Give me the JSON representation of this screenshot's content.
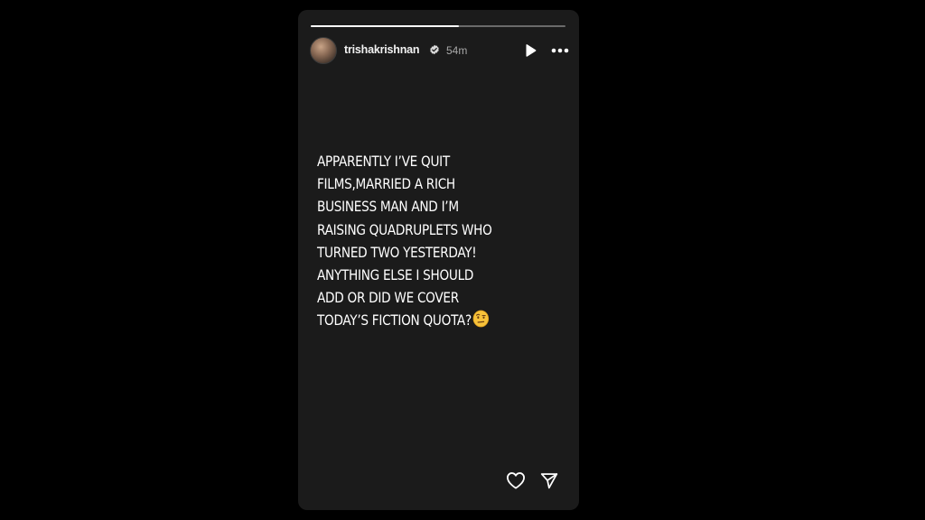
{
  "story": {
    "progress": 0.58,
    "author": {
      "username": "trishakrishnan",
      "verified": true,
      "avatar_icon": "profile-photo"
    },
    "time_ago": "54m",
    "text_lines": [
      "APPARENTLY I’VE QUIT",
      "FILMS,MARRIED A RICH",
      "BUSINESS MAN AND I’M",
      "RAISING QUADRUPLETS WHO",
      "TURNED TWO YESTERDAY!",
      "ANYTHING ELSE I SHOULD",
      "ADD OR DID WE COVER",
      "TODAY’S FICTION QUOTA?"
    ],
    "emoji": "raised-eyebrow-face",
    "colors": {
      "background": "#000000",
      "card": "#1b1b1b",
      "text": "#ffffff",
      "muted": "#a8a8a8",
      "verified": "#3897f0"
    }
  },
  "controls": {
    "play_icon": "play-icon",
    "more_icon": "more-options-icon",
    "like_icon": "heart-icon",
    "share_icon": "send-icon"
  }
}
